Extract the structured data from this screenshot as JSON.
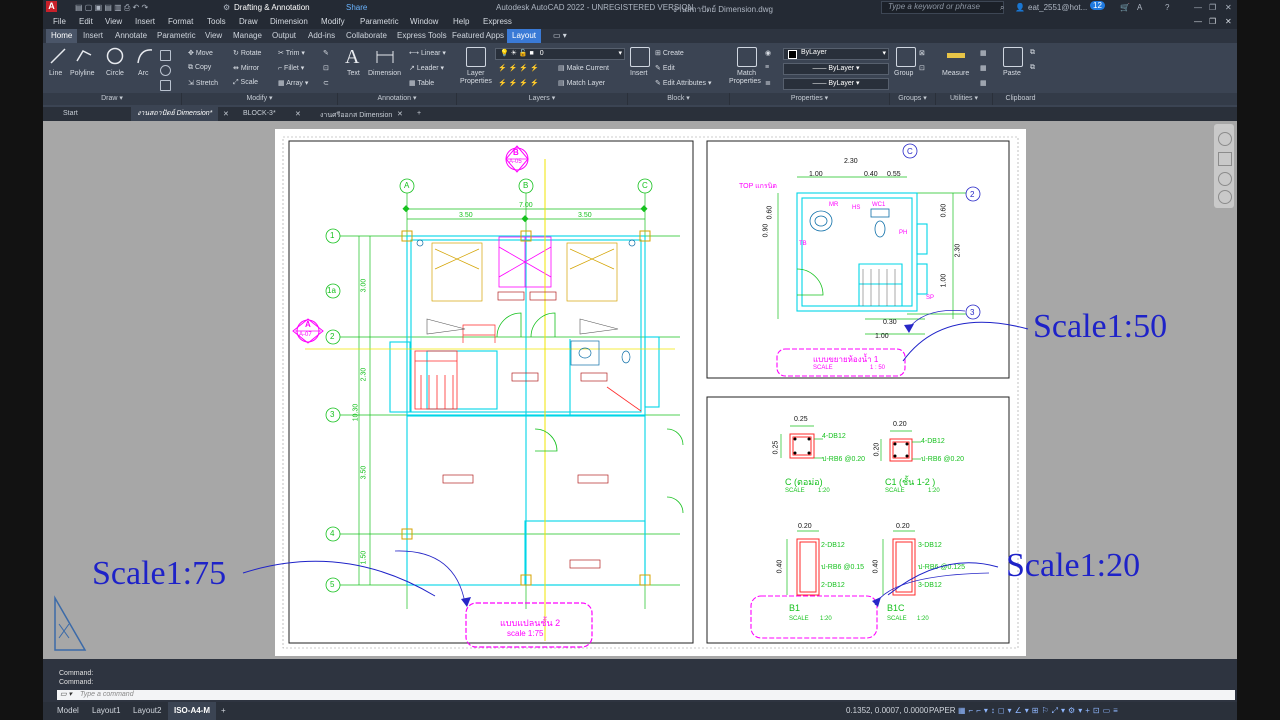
{
  "title_bar": {
    "workspace": "Drafting & Annotation",
    "share": "Share",
    "app_title": "Autodesk AutoCAD 2022 - UNREGISTERED VERSION",
    "document_title": "งานสถาปัตย์ Dimension.dwg",
    "search_placeholder": "Type a keyword or phrase",
    "user": "eat_2551@hot...",
    "notifications": "12"
  },
  "menu_bar": [
    "File",
    "Edit",
    "View",
    "Insert",
    "Format",
    "Tools",
    "Draw",
    "Dimension",
    "Modify",
    "Parametric",
    "Window",
    "Help",
    "Express"
  ],
  "ribbon_tabs": [
    "Home",
    "Insert",
    "Annotate",
    "Parametric",
    "View",
    "Manage",
    "Output",
    "Add-ins",
    "Collaborate",
    "Express Tools",
    "Featured Apps",
    "Layout"
  ],
  "ribbon": {
    "draw": {
      "line": "Line",
      "polyline": "Polyline",
      "circle": "Circle",
      "arc": "Arc",
      "panel": "Draw"
    },
    "modify": {
      "move": "Move",
      "rotate": "Rotate",
      "trim": "Trim",
      "copy": "Copy",
      "mirror": "Mirror",
      "fillet": "Fillet",
      "stretch": "Stretch",
      "scale": "Scale",
      "array": "Array",
      "panel": "Modify"
    },
    "annotation": {
      "text": "Text",
      "dimension": "Dimension",
      "linear": "Linear",
      "leader": "Leader",
      "table": "Table",
      "panel": "Annotation"
    },
    "layers": {
      "layer_properties_1": "Layer",
      "layer_properties_2": "Properties",
      "current_layer": "0",
      "make_current": "Make Current",
      "match_layer": "Match Layer",
      "panel": "Layers"
    },
    "block": {
      "insert": "Insert",
      "create": "Create",
      "edit": "Edit",
      "edit_attributes": "Edit Attributes",
      "panel": "Block"
    },
    "properties": {
      "match_1": "Match",
      "match_2": "Properties",
      "bylayer_color": "ByLayer",
      "bylayer_linetype": "ByLayer",
      "bylayer_lineweight": "ByLayer",
      "panel": "Properties"
    },
    "groups": {
      "group": "Group",
      "panel": "Groups"
    },
    "utilities": {
      "measure": "Measure",
      "panel": "Utilities"
    },
    "clipboard": {
      "paste": "Paste",
      "panel": "Clipboard"
    }
  },
  "doc_tabs": [
    "Start",
    "งานสถาปัตย์ Dimension*",
    "BLOCK-3*",
    "งานศรีออกส Dimension"
  ],
  "drawing": {
    "grid_cols": [
      "A",
      "B",
      "C"
    ],
    "grid_rows": [
      "1",
      "1a",
      "2",
      "3",
      "4",
      "5"
    ],
    "dims_top": [
      "7.00",
      "3.50",
      "3.50"
    ],
    "dims_left": [
      "3.00",
      "2.30",
      "3.50",
      "1.50",
      "10.30"
    ],
    "section_b": "B",
    "section_b_ref": "A-05",
    "section_a": "A",
    "section_a_ref": "A-07",
    "plan_title": "แบบแปลนชั้น 2",
    "plan_scale": "scale 1:75",
    "bath_dims": [
      "2.30",
      "1.00",
      "0.40",
      "0.55",
      "0.60",
      "0.90",
      "0.60",
      "2.30",
      "1.00",
      "0.30",
      "1.00"
    ],
    "bath_labels": [
      "TOP แกรนิต",
      "MR",
      "HS",
      "WC1",
      "TB",
      "PH",
      "SP"
    ],
    "bath_grid": [
      "C",
      "2",
      "3"
    ],
    "bath_title": "แบบขยายห้องน้ำ 1",
    "bath_scale_label": "SCALE",
    "bath_scale": "1 : 50",
    "col_c": {
      "dim": "0.25",
      "rebar": "4-DB12",
      "stirrup": "ป-RB6 @0.20",
      "title": "C  (ตอม่อ)",
      "scale_label": "SCALE",
      "scale": "1:20"
    },
    "col_c1": {
      "dim": "0.20",
      "rebar": "4-DB12",
      "stirrup": "ป-RB6 @0.20",
      "title": "C1 (ชั้น 1-2 )",
      "scale_label": "SCALE",
      "scale": "1:20"
    },
    "beam_b1": {
      "dim": "0.20",
      "height": "0.40",
      "top": "2-DB12",
      "stirrup": "ป-RB6 @0.15",
      "bottom": "2-DB12",
      "title": "B1",
      "scale_label": "SCALE",
      "scale": "1:20"
    },
    "beam_b1c": {
      "dim": "0.20",
      "height": "0.40",
      "top": "3-DB12",
      "stirrup": "ป-RB6 @0.125",
      "bottom": "3-DB12",
      "title": "B1C",
      "scale_label": "SCALE",
      "scale": "1:20"
    }
  },
  "annotations": {
    "scale_75": "Scale1:75",
    "scale_50": "Scale1:50",
    "scale_20": "Scale1:20"
  },
  "command": {
    "line1": "Command:",
    "line2": "Command:",
    "placeholder": "Type a command"
  },
  "status": {
    "tabs": [
      "Model",
      "Layout1",
      "Layout2",
      "ISO-A4-M"
    ],
    "coords": "0.1352, 0.0007, 0.0000",
    "mode": "PAPER"
  },
  "colors": {
    "cad_green": "#16c11e",
    "cad_cyan": "#00d5e6",
    "cad_magenta": "#ff00ff",
    "cad_yellow": "#f2e600",
    "cad_red": "#ff2a2a",
    "annotation_blue": "#1e22c8"
  }
}
